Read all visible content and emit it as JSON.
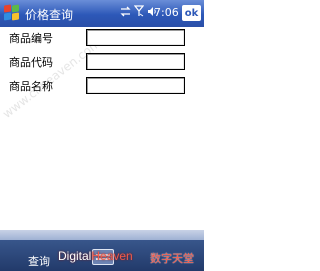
{
  "titlebar": {
    "title": "价格查询",
    "time": "7:06",
    "ok_label": "ok",
    "icons": [
      "start-menu-icon",
      "connectivity-icon",
      "antenna-signal-icon",
      "speaker-volume-icon"
    ]
  },
  "form": {
    "fields": [
      {
        "label": "商品编号",
        "value": ""
      },
      {
        "label": "商品代码",
        "value": ""
      },
      {
        "label": "商品名称",
        "value": ""
      }
    ]
  },
  "softkeys": {
    "left": "查询"
  },
  "watermark": "www.cnheaven.com",
  "brand": {
    "prefix": "Digital",
    "suffix": "Heaven",
    "cn": "数字天堂"
  },
  "colors": {
    "titlebar": "#2d58b8",
    "bottombar": "#223a6a",
    "brand_accent": "#f05a4a"
  }
}
